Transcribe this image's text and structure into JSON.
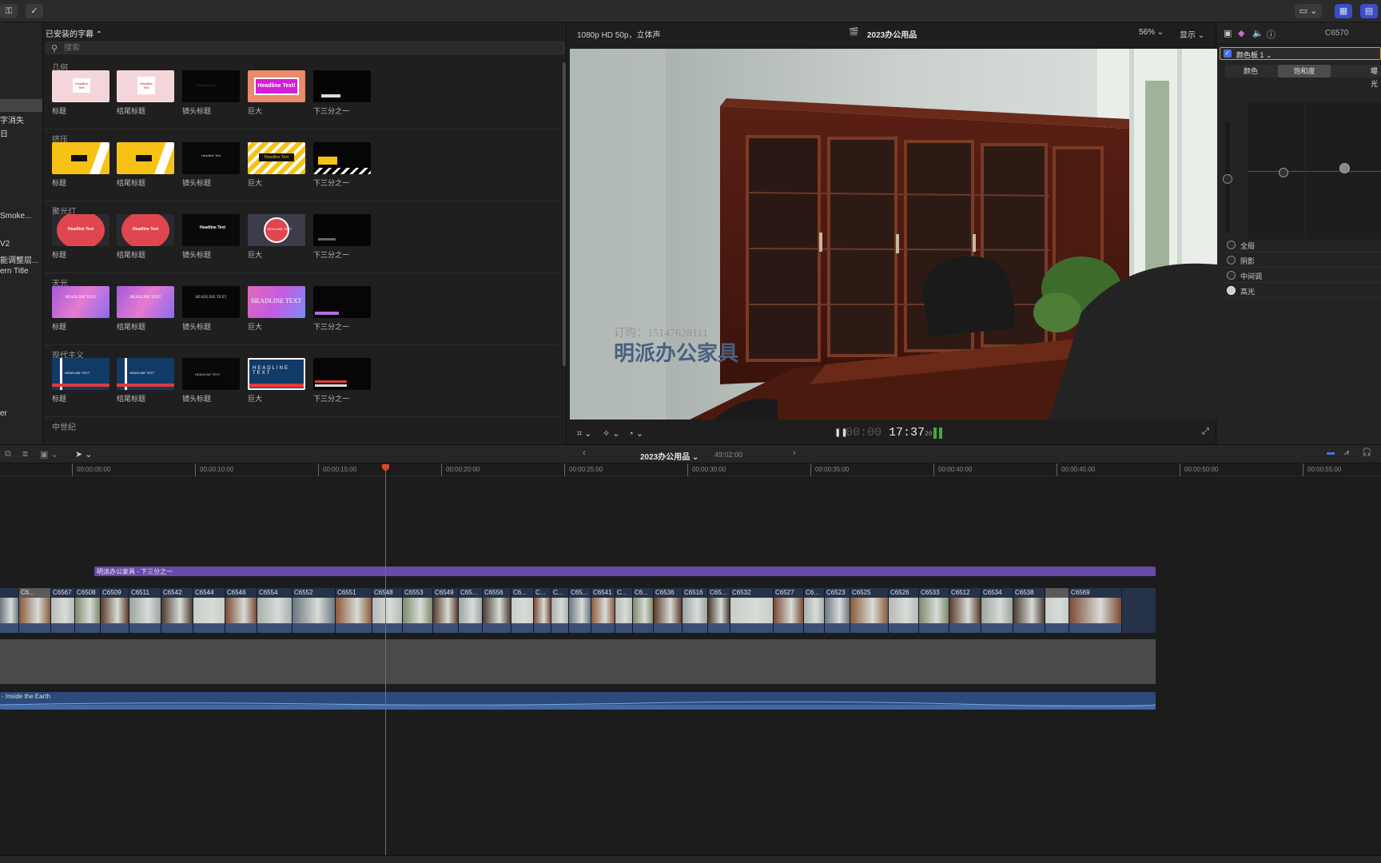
{
  "browser": {
    "title": "已安装的字幕",
    "search_placeholder": "搜索",
    "categories": [
      {
        "name": "几何",
        "tiles": [
          "标题",
          "结尾标题",
          "镜头标题",
          "巨大",
          "下三分之一"
        ]
      },
      {
        "name": "挤压",
        "tiles": [
          "标题",
          "结尾标题",
          "镜头标题",
          "巨大",
          "下三分之一"
        ]
      },
      {
        "name": "聚光灯",
        "tiles": [
          "标题",
          "结尾标题",
          "镜头标题",
          "巨大",
          "下三分之一"
        ]
      },
      {
        "name": "天光",
        "tiles": [
          "标题",
          "结尾标题",
          "镜头标题",
          "巨大",
          "下三分之一"
        ]
      },
      {
        "name": "现代主义",
        "tiles": [
          "标题",
          "结尾标题",
          "镜头标题",
          "巨大",
          "下三分之一"
        ]
      },
      {
        "name": "中世纪",
        "tiles": []
      }
    ],
    "thumb_texts": {
      "headline": "Headline Text",
      "headline_upper": "HEADLINE TEXT",
      "headline_excl": "Headline Text!"
    }
  },
  "sidebar": {
    "items": [
      "字消失",
      "日",
      "Smoke...",
      "V2",
      "能调整层...",
      "ern Title",
      "er"
    ]
  },
  "viewer": {
    "format": "1080p HD 50p，立体声",
    "project": "2023办公用品",
    "zoom": "56%",
    "display": "显示",
    "overlay_small": "订购：15147628111",
    "overlay_big": "明派办公家具",
    "timecode_dim": "00:00",
    "timecode_main": "17:37",
    "timecode_frames": "20"
  },
  "inspector": {
    "clip_name": "C6570",
    "board": "颜色板 1",
    "tabs": [
      "颜色",
      "饱和度",
      "曝光"
    ],
    "ranges": [
      "全局",
      "阴影",
      "中间调",
      "高光"
    ]
  },
  "timeline": {
    "project": "2023办公用品",
    "duration": "49:02:00",
    "ruler": [
      "00:00:05:00",
      "00:00:10:00",
      "00:00:15:00",
      "00:00:20:00",
      "00:00:25:00",
      "00:00:30:00",
      "00:00:35:00",
      "00:00:40:00",
      "00:00:45:00",
      "00:00:50:00",
      "00:00:55:00"
    ],
    "title_clip": "明派办公家具 - 下三分之一",
    "clips": [
      "",
      "C6...",
      "C6567",
      "C6508",
      "C6509",
      "C6511",
      "C6542",
      "C6544",
      "C6546",
      "C6554",
      "C6552",
      "C6551",
      "C6548",
      "C6553",
      "C6549",
      "C65...",
      "C6556",
      "C6...",
      "C...",
      "C...",
      "C65...",
      "C6541",
      "C...",
      "C6...",
      "C6536",
      "C6516",
      "C65...",
      "C6532",
      "C6527",
      "C6...",
      "C6523",
      "C6525",
      "C6526",
      "C6533",
      "C6512",
      "C6534",
      "C6538",
      "",
      "C6569"
    ],
    "music": "- Inside the Earth"
  },
  "colors": {
    "accent": "#4b6fe6",
    "playhead": "#d9452e",
    "title_clip": "#6a4aa8",
    "story_clip": "#25324a",
    "music_clip": "#2c4a7a"
  }
}
